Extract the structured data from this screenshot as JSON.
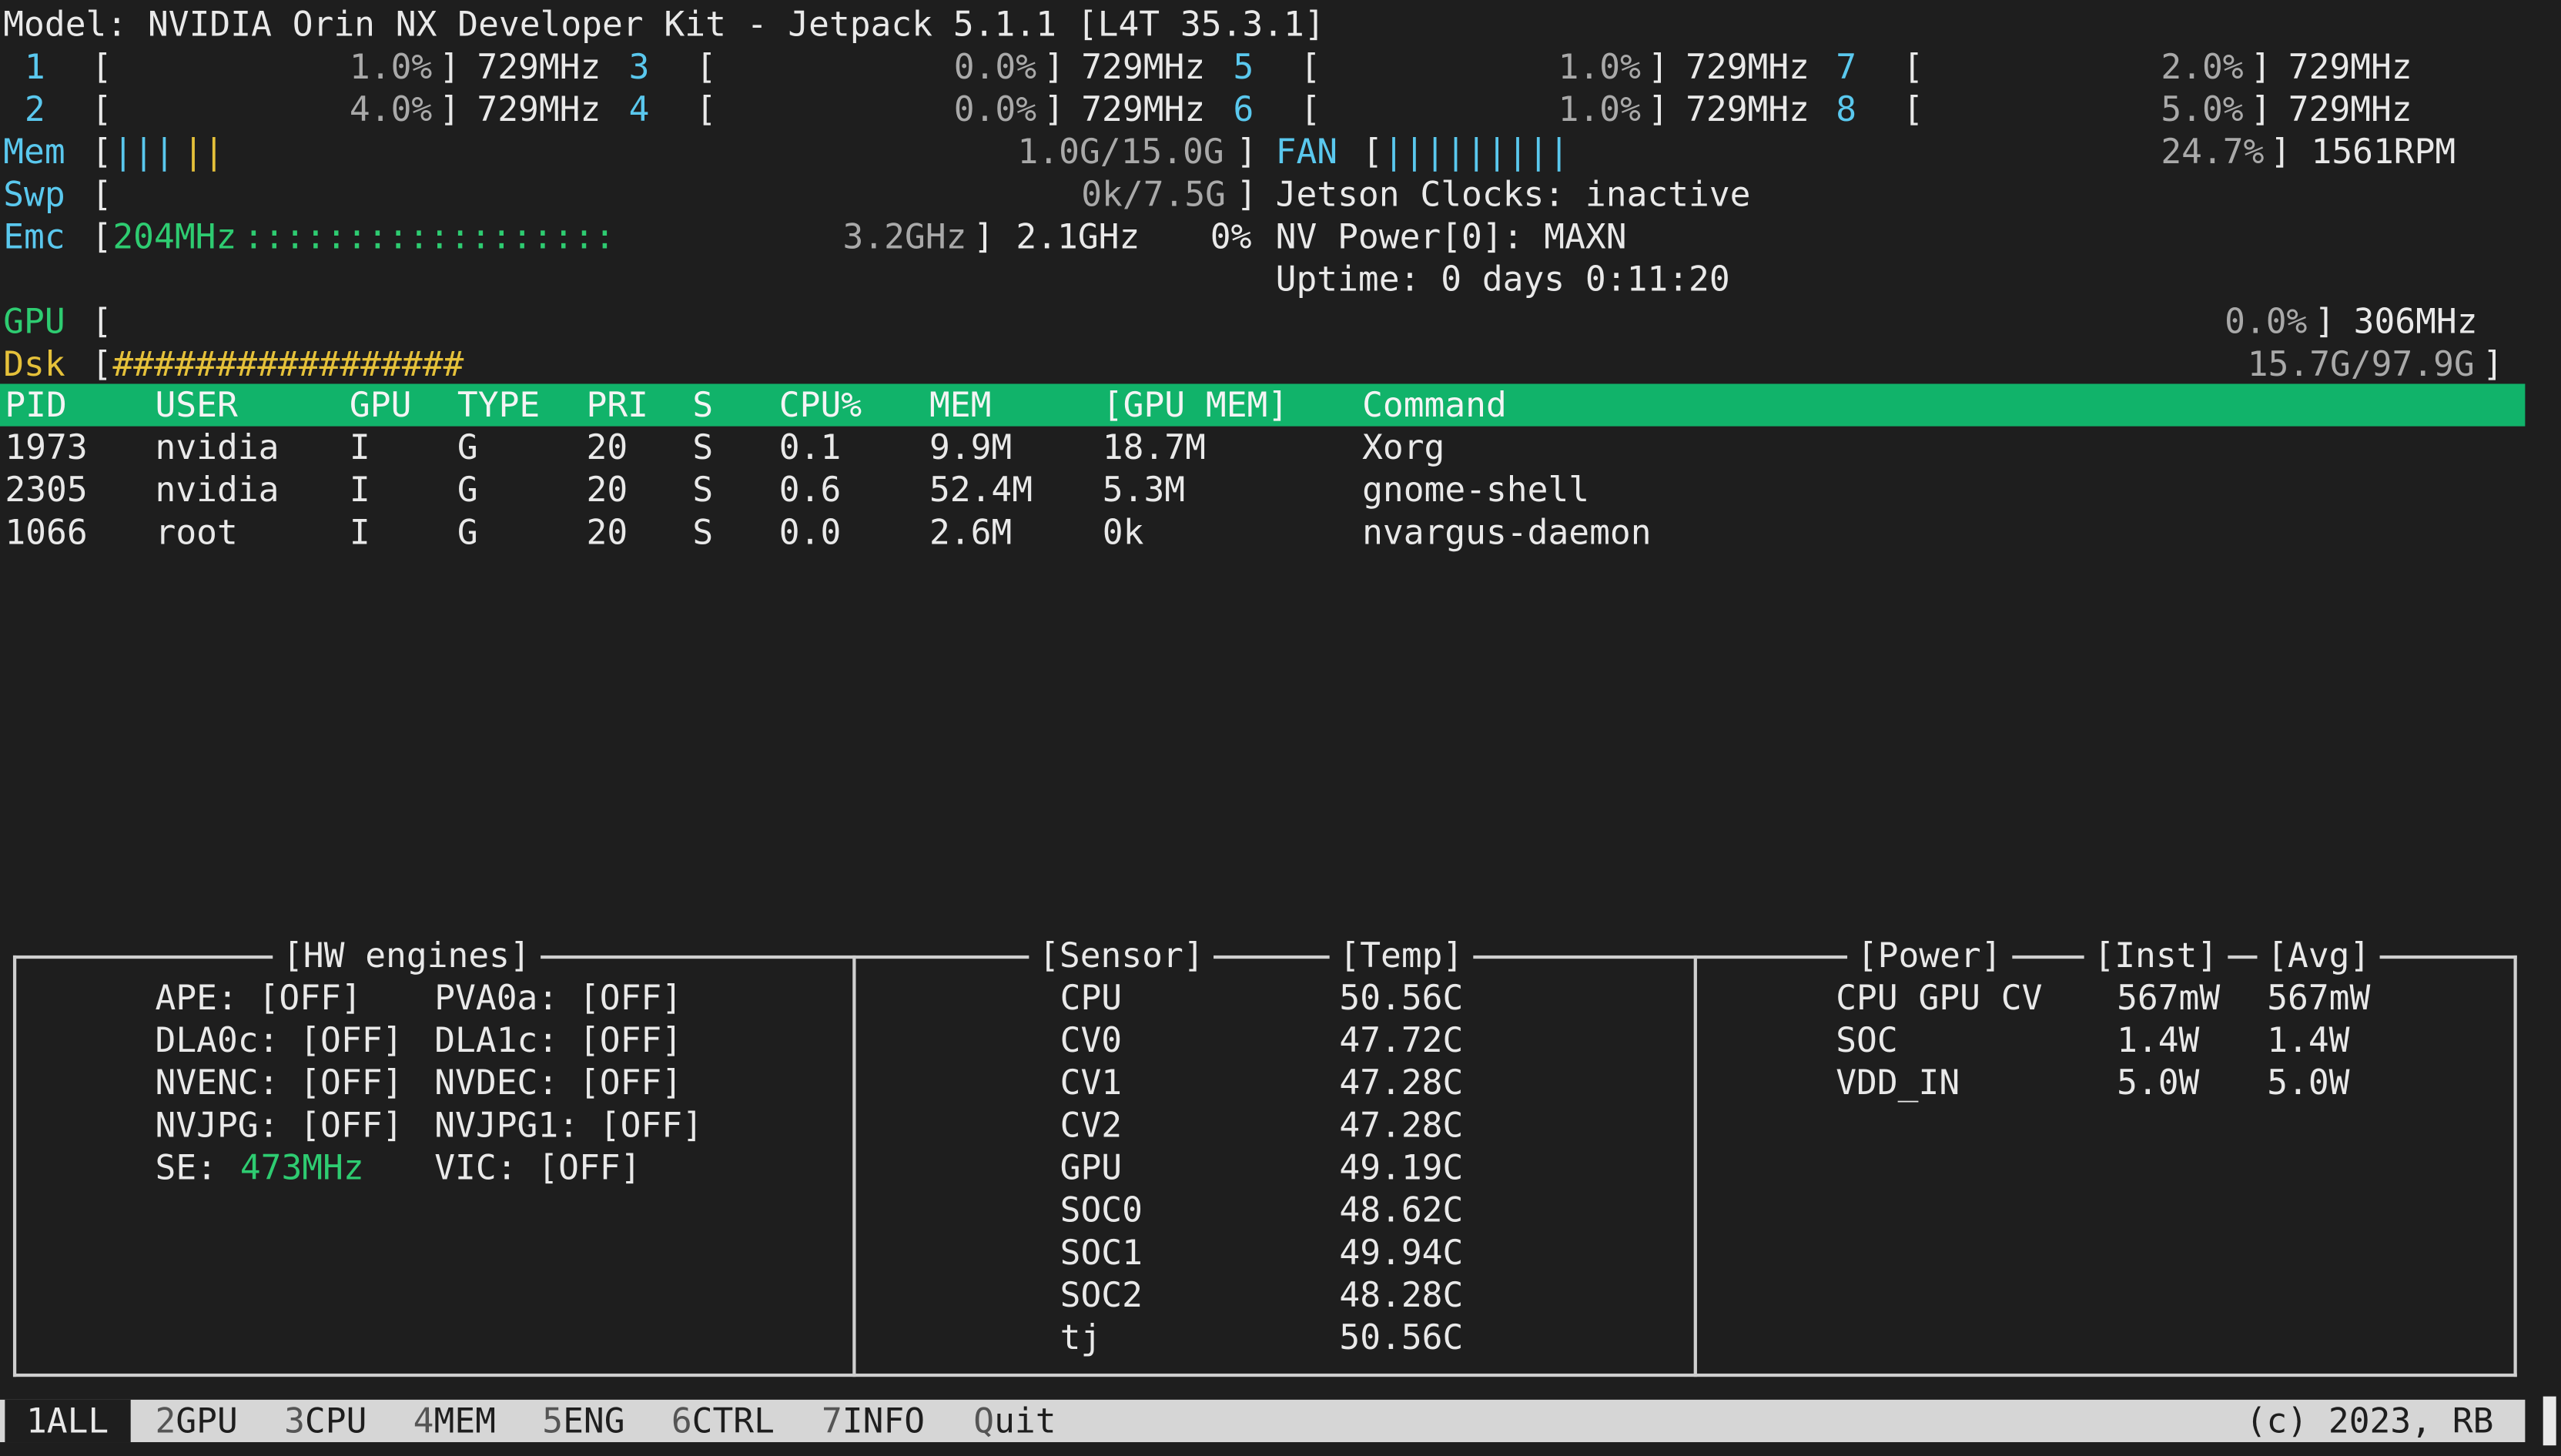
{
  "model_line": "Model: NVIDIA Orin NX Developer Kit - Jetpack 5.1.1 [L4T 35.3.1]",
  "cpus": [
    {
      "id": "1",
      "pct": "1.0%",
      "freq": "729MHz"
    },
    {
      "id": "2",
      "pct": "4.0%",
      "freq": "729MHz"
    },
    {
      "id": "3",
      "pct": "0.0%",
      "freq": "729MHz"
    },
    {
      "id": "4",
      "pct": "0.0%",
      "freq": "729MHz"
    },
    {
      "id": "5",
      "pct": "1.0%",
      "freq": "729MHz"
    },
    {
      "id": "6",
      "pct": "1.0%",
      "freq": "729MHz"
    },
    {
      "id": "7",
      "pct": "2.0%",
      "freq": "729MHz"
    },
    {
      "id": "8",
      "pct": "5.0%",
      "freq": "729MHz"
    }
  ],
  "mem": {
    "label": "Mem",
    "bars_blue": "|||",
    "bars_yellow": "||",
    "value": "1.0G/15.0G"
  },
  "swp": {
    "label": "Swp",
    "value": "0k/7.5G"
  },
  "emc": {
    "label": "Emc",
    "freq": "204MHz",
    "dots": "::::::::::::::::::",
    "max": "3.2GHz",
    "cur": "2.1GHz",
    "pct": "0%"
  },
  "fan": {
    "label": "FAN",
    "bars": "|||||||||",
    "pct": "24.7%",
    "rpm": "1561RPM"
  },
  "jetson_clocks": "Jetson Clocks: inactive",
  "nv_power": "NV Power[0]: MAXN",
  "uptime": "Uptime: 0 days 0:11:20",
  "gpu": {
    "label": "GPU",
    "pct": "0.0%",
    "freq": "306MHz"
  },
  "dsk": {
    "label": "Dsk",
    "bars": "#################",
    "value": "15.7G/97.9G"
  },
  "proc_headers": [
    "PID",
    "USER",
    "GPU",
    "TYPE",
    "PRI",
    "S",
    "CPU%",
    "MEM",
    "[GPU MEM]",
    "Command"
  ],
  "processes": [
    [
      "1973",
      "nvidia",
      "I",
      "G",
      "20",
      "S",
      "0.1",
      "9.9M",
      "18.7M",
      "Xorg"
    ],
    [
      "2305",
      "nvidia",
      "I",
      "G",
      "20",
      "S",
      "0.6",
      "52.4M",
      "5.3M",
      "gnome-shell"
    ],
    [
      "1066",
      "root",
      "I",
      "G",
      "20",
      "S",
      "0.0",
      "2.6M",
      "0k",
      "nvargus-daemon"
    ]
  ],
  "hw_engines": {
    "title": "[HW engines]",
    "rows": [
      [
        "APE: [OFF]",
        "PVA0a: [OFF]"
      ],
      [
        "DLA0c: [OFF]",
        "DLA1c: [OFF]"
      ],
      [
        "NVENC: [OFF]",
        "NVDEC: [OFF]"
      ],
      [
        "NVJPG: [OFF]",
        "NVJPG1: [OFF]"
      ],
      [
        "SE:",
        "VIC: [OFF]"
      ]
    ],
    "se_value": "473MHz"
  },
  "sensors": {
    "title": "[Sensor]",
    "temp_title": "[Temp]",
    "rows": [
      [
        "CPU",
        "50.56C"
      ],
      [
        "CV0",
        "47.72C"
      ],
      [
        "CV1",
        "47.28C"
      ],
      [
        "CV2",
        "47.28C"
      ],
      [
        "GPU",
        "49.19C"
      ],
      [
        "SOC0",
        "48.62C"
      ],
      [
        "SOC1",
        "49.94C"
      ],
      [
        "SOC2",
        "48.28C"
      ],
      [
        "tj",
        "50.56C"
      ]
    ]
  },
  "power": {
    "title": "[Power]",
    "inst_title": "[Inst]",
    "avg_title": "[Avg]",
    "rows": [
      [
        "CPU GPU CV",
        "567mW",
        "567mW"
      ],
      [
        "SOC",
        "1.4W",
        "1.4W"
      ],
      [
        "VDD_IN",
        "5.0W",
        "5.0W"
      ]
    ]
  },
  "footer": {
    "tabs": [
      {
        "num": "1",
        "label": "ALL"
      },
      {
        "num": "2",
        "label": "GPU"
      },
      {
        "num": "3",
        "label": "CPU"
      },
      {
        "num": "4",
        "label": "MEM"
      },
      {
        "num": "5",
        "label": "ENG"
      },
      {
        "num": "6",
        "label": "CTRL"
      },
      {
        "num": "7",
        "label": "INFO"
      },
      {
        "num": "Q",
        "label": "uit"
      }
    ],
    "copyright": "(c) 2023, RB"
  }
}
